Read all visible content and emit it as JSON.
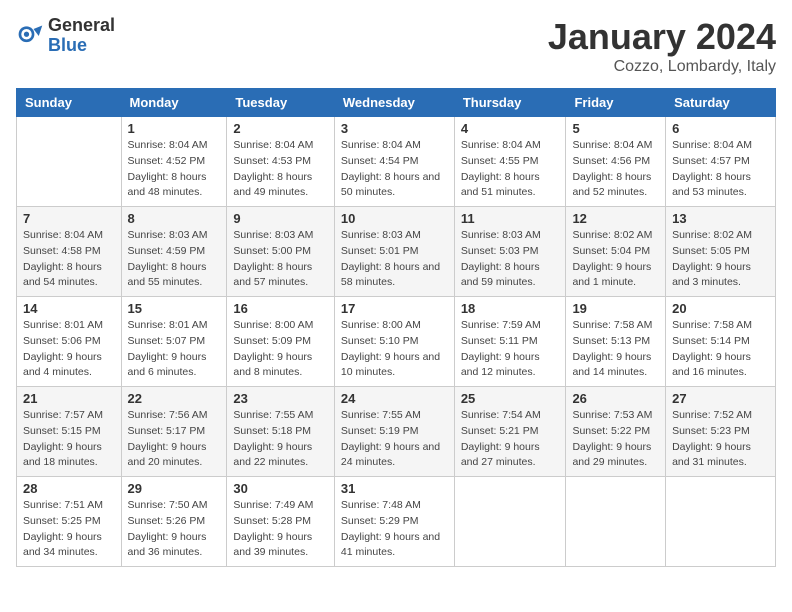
{
  "header": {
    "logo_general": "General",
    "logo_blue": "Blue",
    "title": "January 2024",
    "location": "Cozzo, Lombardy, Italy"
  },
  "weekdays": [
    "Sunday",
    "Monday",
    "Tuesday",
    "Wednesday",
    "Thursday",
    "Friday",
    "Saturday"
  ],
  "weeks": [
    [
      {
        "day": "",
        "sunrise": "",
        "sunset": "",
        "daylight": ""
      },
      {
        "day": "1",
        "sunrise": "Sunrise: 8:04 AM",
        "sunset": "Sunset: 4:52 PM",
        "daylight": "Daylight: 8 hours and 48 minutes."
      },
      {
        "day": "2",
        "sunrise": "Sunrise: 8:04 AM",
        "sunset": "Sunset: 4:53 PM",
        "daylight": "Daylight: 8 hours and 49 minutes."
      },
      {
        "day": "3",
        "sunrise": "Sunrise: 8:04 AM",
        "sunset": "Sunset: 4:54 PM",
        "daylight": "Daylight: 8 hours and 50 minutes."
      },
      {
        "day": "4",
        "sunrise": "Sunrise: 8:04 AM",
        "sunset": "Sunset: 4:55 PM",
        "daylight": "Daylight: 8 hours and 51 minutes."
      },
      {
        "day": "5",
        "sunrise": "Sunrise: 8:04 AM",
        "sunset": "Sunset: 4:56 PM",
        "daylight": "Daylight: 8 hours and 52 minutes."
      },
      {
        "day": "6",
        "sunrise": "Sunrise: 8:04 AM",
        "sunset": "Sunset: 4:57 PM",
        "daylight": "Daylight: 8 hours and 53 minutes."
      }
    ],
    [
      {
        "day": "7",
        "sunrise": "Sunrise: 8:04 AM",
        "sunset": "Sunset: 4:58 PM",
        "daylight": "Daylight: 8 hours and 54 minutes."
      },
      {
        "day": "8",
        "sunrise": "Sunrise: 8:03 AM",
        "sunset": "Sunset: 4:59 PM",
        "daylight": "Daylight: 8 hours and 55 minutes."
      },
      {
        "day": "9",
        "sunrise": "Sunrise: 8:03 AM",
        "sunset": "Sunset: 5:00 PM",
        "daylight": "Daylight: 8 hours and 57 minutes."
      },
      {
        "day": "10",
        "sunrise": "Sunrise: 8:03 AM",
        "sunset": "Sunset: 5:01 PM",
        "daylight": "Daylight: 8 hours and 58 minutes."
      },
      {
        "day": "11",
        "sunrise": "Sunrise: 8:03 AM",
        "sunset": "Sunset: 5:03 PM",
        "daylight": "Daylight: 8 hours and 59 minutes."
      },
      {
        "day": "12",
        "sunrise": "Sunrise: 8:02 AM",
        "sunset": "Sunset: 5:04 PM",
        "daylight": "Daylight: 9 hours and 1 minute."
      },
      {
        "day": "13",
        "sunrise": "Sunrise: 8:02 AM",
        "sunset": "Sunset: 5:05 PM",
        "daylight": "Daylight: 9 hours and 3 minutes."
      }
    ],
    [
      {
        "day": "14",
        "sunrise": "Sunrise: 8:01 AM",
        "sunset": "Sunset: 5:06 PM",
        "daylight": "Daylight: 9 hours and 4 minutes."
      },
      {
        "day": "15",
        "sunrise": "Sunrise: 8:01 AM",
        "sunset": "Sunset: 5:07 PM",
        "daylight": "Daylight: 9 hours and 6 minutes."
      },
      {
        "day": "16",
        "sunrise": "Sunrise: 8:00 AM",
        "sunset": "Sunset: 5:09 PM",
        "daylight": "Daylight: 9 hours and 8 minutes."
      },
      {
        "day": "17",
        "sunrise": "Sunrise: 8:00 AM",
        "sunset": "Sunset: 5:10 PM",
        "daylight": "Daylight: 9 hours and 10 minutes."
      },
      {
        "day": "18",
        "sunrise": "Sunrise: 7:59 AM",
        "sunset": "Sunset: 5:11 PM",
        "daylight": "Daylight: 9 hours and 12 minutes."
      },
      {
        "day": "19",
        "sunrise": "Sunrise: 7:58 AM",
        "sunset": "Sunset: 5:13 PM",
        "daylight": "Daylight: 9 hours and 14 minutes."
      },
      {
        "day": "20",
        "sunrise": "Sunrise: 7:58 AM",
        "sunset": "Sunset: 5:14 PM",
        "daylight": "Daylight: 9 hours and 16 minutes."
      }
    ],
    [
      {
        "day": "21",
        "sunrise": "Sunrise: 7:57 AM",
        "sunset": "Sunset: 5:15 PM",
        "daylight": "Daylight: 9 hours and 18 minutes."
      },
      {
        "day": "22",
        "sunrise": "Sunrise: 7:56 AM",
        "sunset": "Sunset: 5:17 PM",
        "daylight": "Daylight: 9 hours and 20 minutes."
      },
      {
        "day": "23",
        "sunrise": "Sunrise: 7:55 AM",
        "sunset": "Sunset: 5:18 PM",
        "daylight": "Daylight: 9 hours and 22 minutes."
      },
      {
        "day": "24",
        "sunrise": "Sunrise: 7:55 AM",
        "sunset": "Sunset: 5:19 PM",
        "daylight": "Daylight: 9 hours and 24 minutes."
      },
      {
        "day": "25",
        "sunrise": "Sunrise: 7:54 AM",
        "sunset": "Sunset: 5:21 PM",
        "daylight": "Daylight: 9 hours and 27 minutes."
      },
      {
        "day": "26",
        "sunrise": "Sunrise: 7:53 AM",
        "sunset": "Sunset: 5:22 PM",
        "daylight": "Daylight: 9 hours and 29 minutes."
      },
      {
        "day": "27",
        "sunrise": "Sunrise: 7:52 AM",
        "sunset": "Sunset: 5:23 PM",
        "daylight": "Daylight: 9 hours and 31 minutes."
      }
    ],
    [
      {
        "day": "28",
        "sunrise": "Sunrise: 7:51 AM",
        "sunset": "Sunset: 5:25 PM",
        "daylight": "Daylight: 9 hours and 34 minutes."
      },
      {
        "day": "29",
        "sunrise": "Sunrise: 7:50 AM",
        "sunset": "Sunset: 5:26 PM",
        "daylight": "Daylight: 9 hours and 36 minutes."
      },
      {
        "day": "30",
        "sunrise": "Sunrise: 7:49 AM",
        "sunset": "Sunset: 5:28 PM",
        "daylight": "Daylight: 9 hours and 39 minutes."
      },
      {
        "day": "31",
        "sunrise": "Sunrise: 7:48 AM",
        "sunset": "Sunset: 5:29 PM",
        "daylight": "Daylight: 9 hours and 41 minutes."
      },
      {
        "day": "",
        "sunrise": "",
        "sunset": "",
        "daylight": ""
      },
      {
        "day": "",
        "sunrise": "",
        "sunset": "",
        "daylight": ""
      },
      {
        "day": "",
        "sunrise": "",
        "sunset": "",
        "daylight": ""
      }
    ]
  ]
}
